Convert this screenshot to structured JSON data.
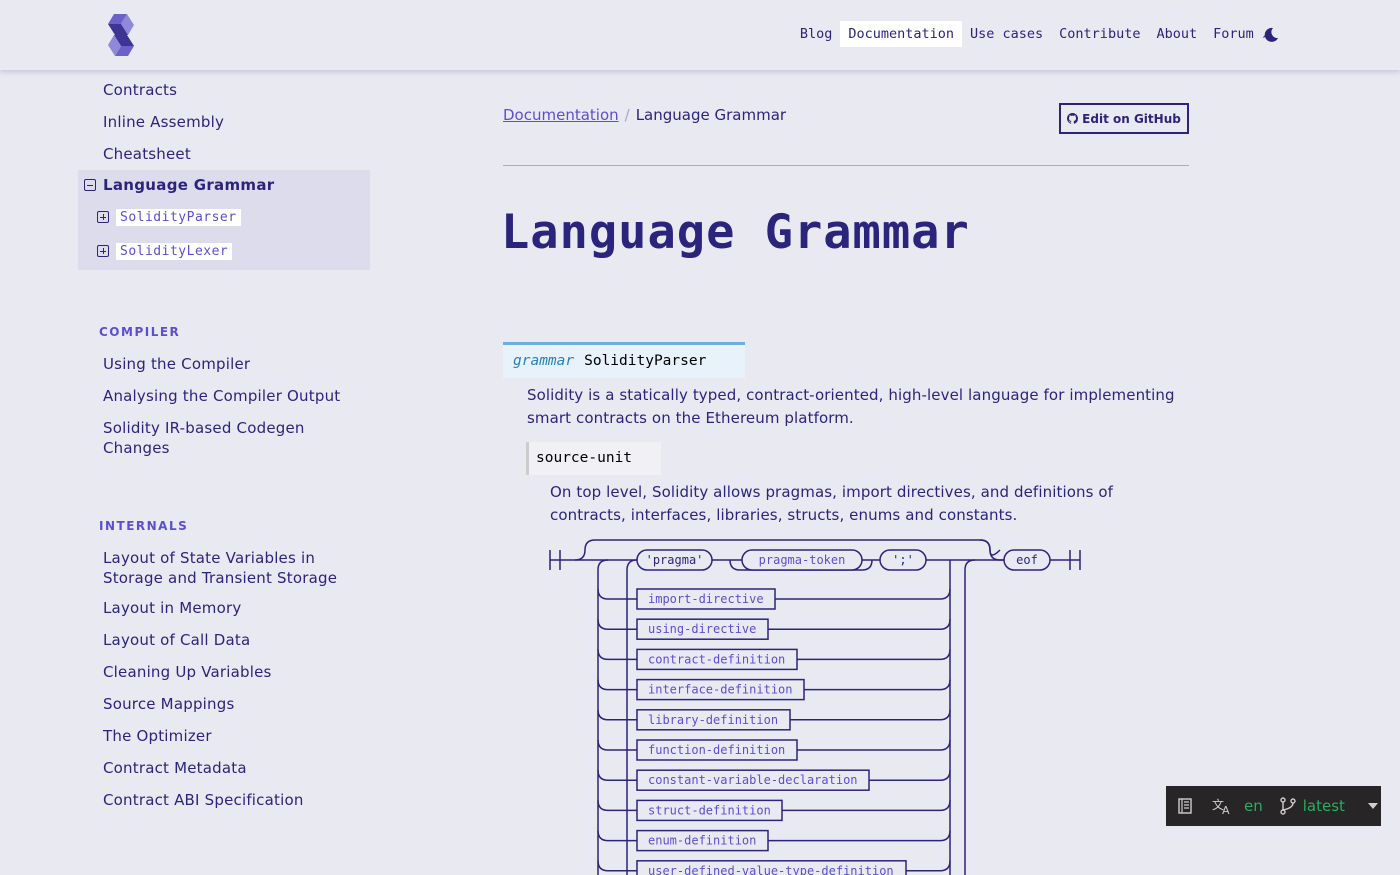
{
  "header": {
    "nav": [
      "Blog",
      "Documentation",
      "Use cases",
      "Contribute",
      "About",
      "Forum ↗"
    ],
    "active_nav": "Documentation",
    "theme_icon": "moon-icon",
    "logo_icon": "solidity-logo-icon"
  },
  "sidebar": {
    "top_links": [
      "Contracts",
      "Inline Assembly",
      "Cheatsheet"
    ],
    "current": {
      "label": "Language Grammar",
      "children": [
        "SolidityParser",
        "SolidityLexer"
      ]
    },
    "sections": [
      {
        "title": "COMPILER",
        "items": [
          "Using the Compiler",
          "Analysing the Compiler Output",
          "Solidity IR-based Codegen Changes"
        ]
      },
      {
        "title": "INTERNALS",
        "items": [
          "Layout of State Variables in Storage and Transient Storage",
          "Layout in Memory",
          "Layout of Call Data",
          "Cleaning Up Variables",
          "Source Mappings",
          "The Optimizer",
          "Contract Metadata",
          "Contract ABI Specification"
        ]
      }
    ]
  },
  "main": {
    "breadcrumb": {
      "root": "Documentation",
      "separator": "/",
      "current": "Language Grammar"
    },
    "edit_button": "Edit on GitHub",
    "title": "Language Grammar",
    "grammar": {
      "keyword": "grammar",
      "name": "SolidityParser",
      "description": "Solidity is a statically typed, contract-oriented, high-level language for implementing smart contracts on the Ethereum platform."
    },
    "rule": {
      "name": "source-unit",
      "description": "On top level, Solidity allows pragmas, import directives, and definitions of contracts, interfaces, libraries, structs, enums and constants."
    },
    "diagram": {
      "terminals": [
        "'pragma'",
        "';'",
        "eof"
      ],
      "top_nonterminal": "pragma-token",
      "nonterminals": [
        "import-directive",
        "using-directive",
        "contract-definition",
        "interface-definition",
        "library-definition",
        "function-definition",
        "constant-variable-declaration",
        "struct-definition",
        "enum-definition",
        "user-defined-value-type-definition"
      ]
    }
  },
  "version_panel": {
    "language": "en",
    "version": "latest",
    "colors": {
      "bg": "#272525",
      "text": "#27ae60"
    }
  },
  "colors": {
    "background": "#e9e9f2",
    "primary": "#2b247c",
    "accent": "#5a4fd0"
  }
}
